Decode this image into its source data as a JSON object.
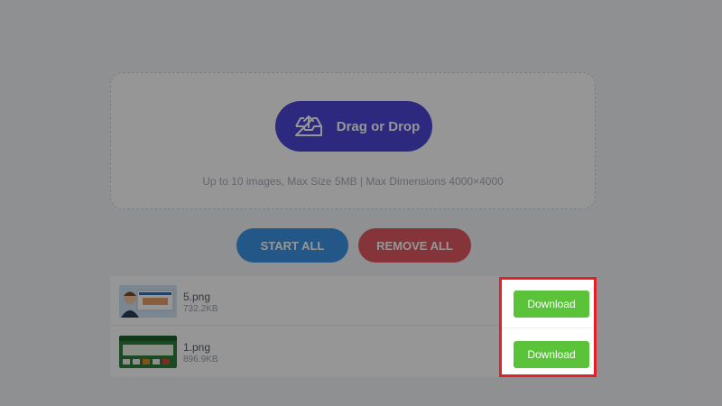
{
  "upload": {
    "drag_label": "Drag or Drop",
    "limits_text": "Up to 10 images, Max Size 5MB | Max Dimensions 4000×4000"
  },
  "actions": {
    "start_all": "START ALL",
    "remove_all": "REMOVE ALL"
  },
  "files": [
    {
      "name": "5.png",
      "size": "732.2KB",
      "download_label": "Download"
    },
    {
      "name": "1.png",
      "size": "896.9KB",
      "download_label": "Download"
    }
  ],
  "colors": {
    "drag_button": "#4b47d6",
    "start_button": "#3d95e6",
    "remove_button": "#e35a61",
    "download_button": "#5bc339",
    "highlight": "#e2202a"
  }
}
